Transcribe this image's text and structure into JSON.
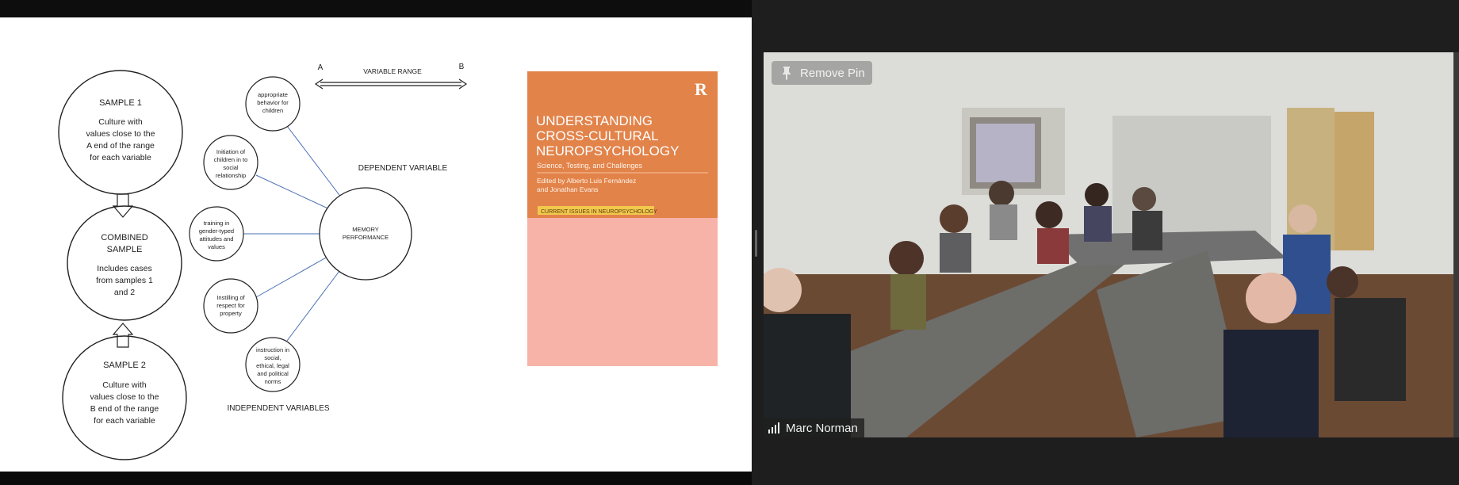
{
  "slide": {
    "sample1": {
      "title": "SAMPLE 1",
      "lines": [
        "Culture with",
        "values close to the",
        "A end of the range",
        "for each variable"
      ]
    },
    "combined": {
      "title": [
        "COMBINED",
        "SAMPLE"
      ],
      "lines": [
        "Includes cases",
        "from samples 1",
        "and 2"
      ]
    },
    "sample2": {
      "title": "SAMPLE 2",
      "lines": [
        "Culture with",
        "values close to the",
        "B end of the range",
        "for each variable"
      ]
    },
    "independent_variables": [
      [
        "appropriate",
        "behavior for",
        "children"
      ],
      [
        "Initiation of",
        "children in to",
        "social",
        "relationship"
      ],
      [
        "training in",
        "gender-typed",
        "attitudes and",
        "values"
      ],
      [
        "Instilling of",
        "respect for",
        "property"
      ],
      [
        "instruction in",
        "social,",
        "ethical, legal",
        "and political",
        "norms"
      ]
    ],
    "memory_node": [
      "MEMORY",
      "PERFORMANCE"
    ],
    "range_a": "A",
    "range_b": "B",
    "variable_range": "VARIABLE RANGE",
    "dependent_label": "DEPENDENT VARIABLE",
    "independent_label": "INDEPENDENT VARIABLES",
    "book": {
      "title_lines": [
        "UNDERSTANDING",
        "CROSS-CULTURAL",
        "NEUROPSYCHOLOGY"
      ],
      "subtitle": "Science, Testing, and Challenges",
      "editors": [
        "Edited by Alberto Luis Fernández",
        "and Jonathan Evans"
      ],
      "series": "CURRENT ISSUES IN NEUROPSYCHOLOGY",
      "publisher_mark": "R",
      "cover_color": "#e2834a"
    }
  },
  "video": {
    "pin_button_label": "Remove Pin",
    "participant_name": "Marc Norman"
  }
}
